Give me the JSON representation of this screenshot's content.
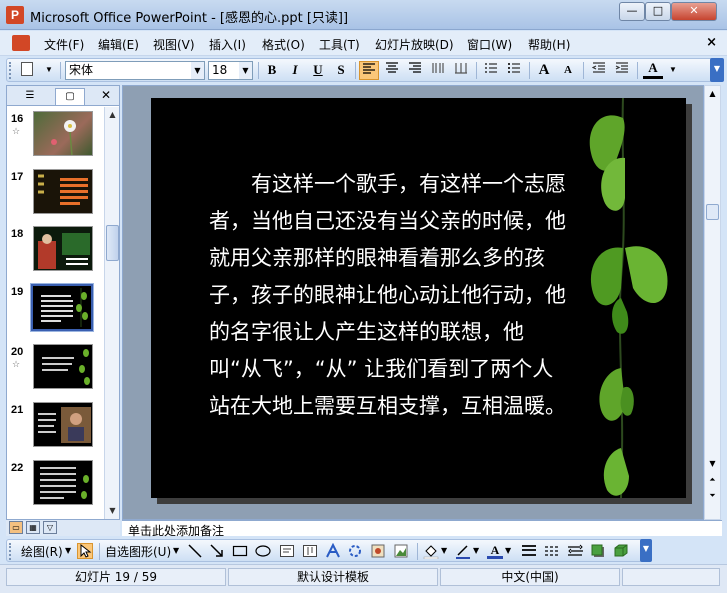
{
  "window": {
    "title": "Microsoft Office PowerPoint - [感恩的心.ppt [只读]]",
    "app_icon_letter": "P",
    "buttons": {
      "minimize": "—",
      "maximize": "□",
      "close": "✕"
    }
  },
  "menubar": {
    "items": [
      {
        "label": "文件(F)"
      },
      {
        "label": "编辑(E)"
      },
      {
        "label": "视图(V)"
      },
      {
        "label": "插入(I)"
      },
      {
        "label": "格式(O)"
      },
      {
        "label": "工具(T)"
      },
      {
        "label": "幻灯片放映(D)"
      },
      {
        "label": "窗口(W)"
      },
      {
        "label": "帮助(H)"
      }
    ],
    "close_doc": "×"
  },
  "toolbar": {
    "font_name": "宋体",
    "font_size": "18",
    "bold": "B",
    "italic": "I",
    "underline": "U",
    "shadow": "S",
    "increase_font": "A",
    "decrease_font": "A",
    "font_color": "A"
  },
  "panel": {
    "close": "✕",
    "slides": [
      {
        "num": "16",
        "star": "☆"
      },
      {
        "num": "17",
        "star": ""
      },
      {
        "num": "18",
        "star": ""
      },
      {
        "num": "19",
        "star": "",
        "selected": true
      },
      {
        "num": "20",
        "star": "☆"
      },
      {
        "num": "21",
        "star": ""
      },
      {
        "num": "22",
        "star": ""
      }
    ]
  },
  "slide": {
    "text": "　　有这样一个歌手，有这样一个志愿者，当他自己还没有当父亲的时候，他就用父亲那样的眼神看着那么多的孩子，孩子的眼神让他心动让他行动，他的名字很让人产生这样的联想，他叫“从飞”，“从” 让我们看到了两个人站在大地上需要互相支撑，互相温暖。"
  },
  "notes": {
    "placeholder": "单击此处添加备注"
  },
  "drawbar": {
    "draw_label": "绘图(R)",
    "autoshapes_label": "自选图形(U)"
  },
  "status": {
    "slide_info": "幻灯片 19 / 59",
    "template": "默认设计模板",
    "language": "中文(中国)"
  }
}
